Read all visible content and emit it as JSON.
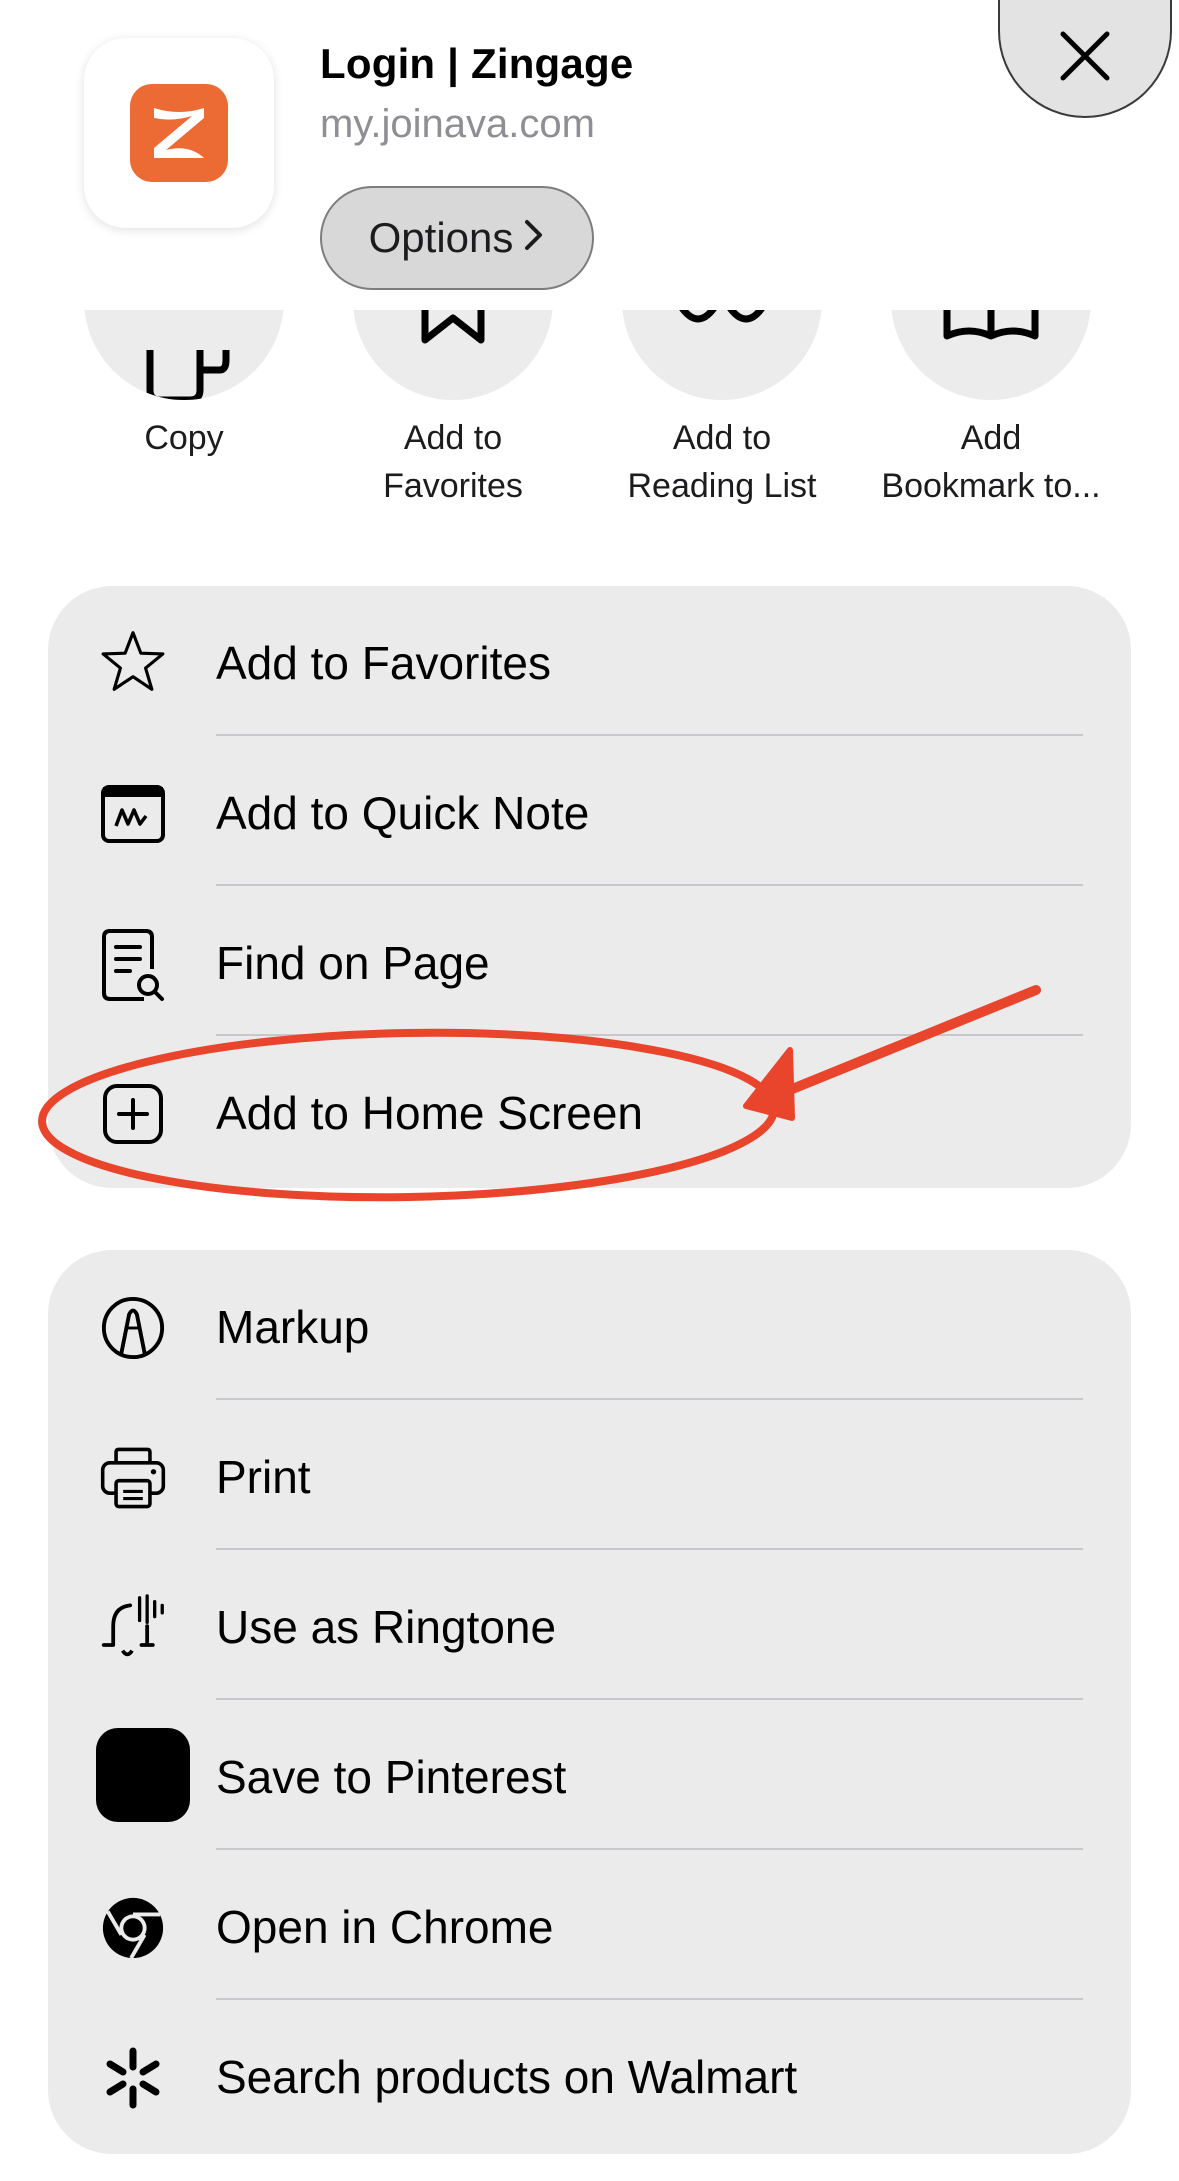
{
  "header": {
    "title": "Login | Zingage",
    "url": "my.joinava.com",
    "options_label": "Options",
    "options_chevron": "›"
  },
  "actions": [
    {
      "label_line1": "Copy",
      "label_line2": "",
      "icon": "copy-icon"
    },
    {
      "label_line1": "Add to",
      "label_line2": "Favorites",
      "icon": "star-icon"
    },
    {
      "label_line1": "Add to",
      "label_line2": "Reading List",
      "icon": "glasses-icon"
    },
    {
      "label_line1": "Add",
      "label_line2": "Bookmark to...",
      "icon": "book-icon"
    }
  ],
  "group1": [
    {
      "label": "Add to Favorites",
      "icon": "star-icon"
    },
    {
      "label": "Add to Quick Note",
      "icon": "quick-note-icon"
    },
    {
      "label": "Find on Page",
      "icon": "find-on-page-icon"
    },
    {
      "label": "Add to Home Screen",
      "icon": "plus-square-icon"
    }
  ],
  "group2": [
    {
      "label": "Markup",
      "icon": "markup-icon"
    },
    {
      "label": "Print",
      "icon": "printer-icon"
    },
    {
      "label": "Use as Ringtone",
      "icon": "bell-icon"
    },
    {
      "label": "Save to Pinterest",
      "icon": "pinterest-icon"
    },
    {
      "label": "Open in Chrome",
      "icon": "chrome-icon"
    },
    {
      "label": "Search products on Walmart",
      "icon": "walmart-icon"
    }
  ],
  "colors": {
    "annotation": "#e8452c",
    "logo": "#ec6a33",
    "group_bg": "#ebebeb"
  }
}
